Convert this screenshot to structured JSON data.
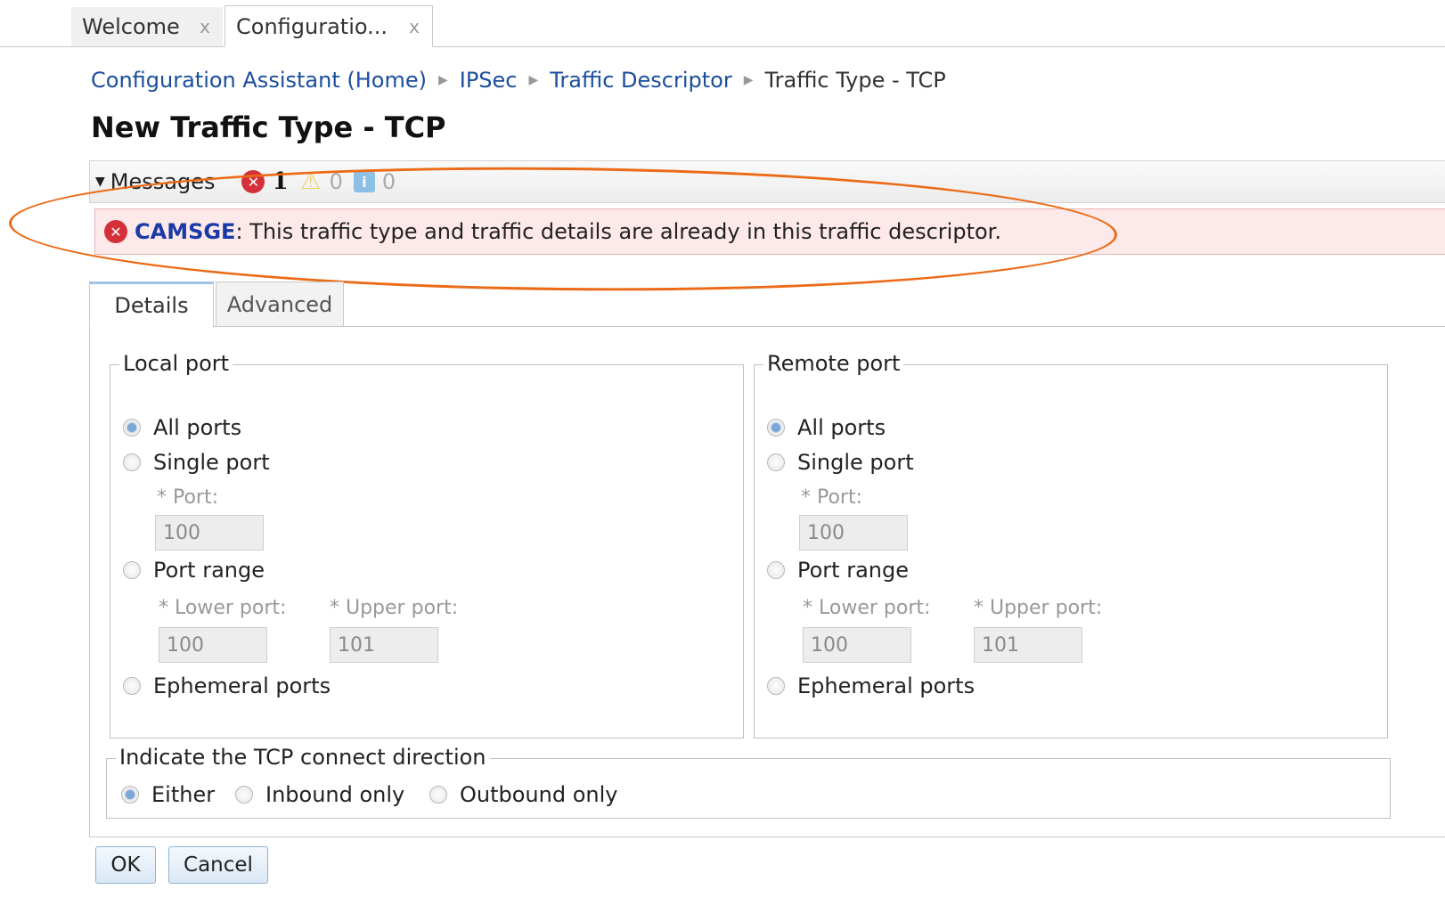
{
  "tabs": [
    {
      "label": "Welcome",
      "close": "x"
    },
    {
      "label": "Configuratio...",
      "close": "x"
    }
  ],
  "breadcrumb": {
    "items": [
      "Configuration Assistant (Home)",
      "IPSec",
      "Traffic Descriptor"
    ],
    "current": "Traffic Type - TCP",
    "separator": "▶"
  },
  "page": {
    "title": "New Traffic Type - TCP"
  },
  "messages": {
    "label": "Messages",
    "error_count": "1",
    "warning_count": "0",
    "info_count": "0",
    "error": {
      "code": "CAMSGE",
      "text": ": This traffic type and traffic details are already in this traffic descriptor."
    }
  },
  "content_tabs": {
    "details": "Details",
    "advanced": "Advanced"
  },
  "local_port": {
    "legend": "Local port",
    "all_ports": "All ports",
    "single_port": "Single port",
    "port_label": "* Port:",
    "port_value": "100",
    "port_range": "Port range",
    "lower_label": "* Lower port:",
    "upper_label": "* Upper port:",
    "lower_value": "100",
    "upper_value": "101",
    "ephemeral": "Ephemeral ports",
    "selected": "all_ports"
  },
  "remote_port": {
    "legend": "Remote port",
    "all_ports": "All ports",
    "single_port": "Single port",
    "port_label": "* Port:",
    "port_value": "100",
    "port_range": "Port range",
    "lower_label": "* Lower port:",
    "upper_label": "* Upper port:",
    "lower_value": "100",
    "upper_value": "101",
    "ephemeral": "Ephemeral ports",
    "selected": "all_ports"
  },
  "direction": {
    "legend": "Indicate the TCP connect direction",
    "either": "Either",
    "inbound": "Inbound only",
    "outbound": "Outbound only",
    "selected": "either"
  },
  "buttons": {
    "ok": "OK",
    "cancel": "Cancel"
  },
  "colors": {
    "link": "#1a4e9c",
    "error": "#d4303a",
    "error_background": "#fde9e9",
    "annotation_oval": "#ec6a16"
  }
}
